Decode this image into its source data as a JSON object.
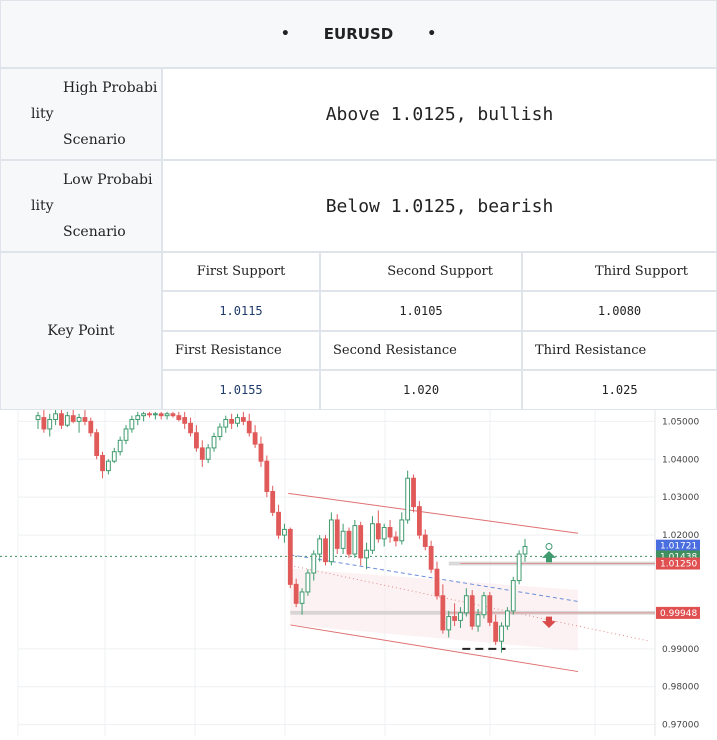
{
  "header": {
    "title": "EURUSD",
    "bullet": "•"
  },
  "rows": {
    "high": {
      "label_lines": [
        "High Probabi",
        "lity",
        "Scenario"
      ],
      "value": "Above 1.0125, bullish"
    },
    "low": {
      "label_lines": [
        "Low Probabi",
        "lity",
        "Scenario"
      ],
      "value": "Below 1.0125, bearish"
    }
  },
  "key_point": {
    "label": "Key Point",
    "support_headers": [
      "First  Support",
      "Second Support",
      "Third  Support"
    ],
    "support_values": [
      "1.0115",
      "1.0105",
      "1.0080"
    ],
    "resistance_headers": [
      "First Resistance",
      "Second Resistance",
      "Third  Resistance"
    ],
    "resistance_values": [
      "1.0155",
      "1.020",
      "1.025"
    ]
  },
  "chart_data": {
    "type": "candlestick",
    "symbol": "EURUSD",
    "y_ticks": [
      "1.05000",
      "1.04000",
      "1.03000",
      "1.02000",
      "0.99000",
      "0.98000",
      "0.97000"
    ],
    "ylim": [
      0.967,
      1.053
    ],
    "price_tags": [
      {
        "label": "1.01721",
        "value": 1.01721,
        "color": "#4a6ee0"
      },
      {
        "label": "1.01438",
        "value": 1.01438,
        "color": "#3f8f5f"
      },
      {
        "label": "1.01250",
        "value": 1.0125,
        "color": "#e05050"
      },
      {
        "label": "0.99948",
        "value": 0.99948,
        "color": "#e05050"
      }
    ],
    "candles": [
      [
        1.0505,
        1.0525,
        1.048,
        1.0515
      ],
      [
        1.051,
        1.053,
        1.047,
        1.048
      ],
      [
        1.048,
        1.052,
        1.046,
        1.0505
      ],
      [
        1.0505,
        1.053,
        1.049,
        1.052
      ],
      [
        1.052,
        1.0535,
        1.048,
        1.049
      ],
      [
        1.049,
        1.0525,
        1.0485,
        1.0515
      ],
      [
        1.0515,
        1.053,
        1.0495,
        1.05
      ],
      [
        1.05,
        1.052,
        1.047,
        1.051
      ],
      [
        1.051,
        1.053,
        1.049,
        1.05
      ],
      [
        1.05,
        1.051,
        1.046,
        1.047
      ],
      [
        1.047,
        1.048,
        1.04,
        1.041
      ],
      [
        1.041,
        1.042,
        1.035,
        1.037
      ],
      [
        1.037,
        1.04,
        1.036,
        1.0395
      ],
      [
        1.0395,
        1.043,
        1.039,
        1.042
      ],
      [
        1.042,
        1.046,
        1.041,
        1.045
      ],
      [
        1.045,
        1.049,
        1.044,
        1.048
      ],
      [
        1.048,
        1.0515,
        1.047,
        1.0505
      ],
      [
        1.0505,
        1.0525,
        1.049,
        1.0515
      ],
      [
        1.0515,
        1.0525,
        1.05,
        1.052
      ],
      [
        1.052,
        1.0525,
        1.051,
        1.0518
      ],
      [
        1.0518,
        1.0525,
        1.0505,
        1.052
      ],
      [
        1.052,
        1.0525,
        1.0505,
        1.0515
      ],
      [
        1.0515,
        1.0525,
        1.0505,
        1.052
      ],
      [
        1.052,
        1.0525,
        1.051,
        1.0515
      ],
      [
        1.0515,
        1.0525,
        1.05,
        1.0505
      ],
      [
        1.051,
        1.0525,
        1.048,
        1.0495
      ],
      [
        1.0495,
        1.051,
        1.046,
        1.047
      ],
      [
        1.047,
        1.049,
        1.042,
        1.043
      ],
      [
        1.043,
        1.045,
        1.038,
        1.04
      ],
      [
        1.04,
        1.044,
        1.039,
        1.043
      ],
      [
        1.043,
        1.047,
        1.042,
        1.046
      ],
      [
        1.046,
        1.0495,
        1.045,
        1.0485
      ],
      [
        1.0485,
        1.0515,
        1.047,
        1.0505
      ],
      [
        1.0505,
        1.052,
        1.048,
        1.0495
      ],
      [
        1.0495,
        1.052,
        1.0485,
        1.051
      ],
      [
        1.051,
        1.0525,
        1.049,
        1.05
      ],
      [
        1.05,
        1.052,
        1.046,
        1.047
      ],
      [
        1.047,
        1.049,
        1.043,
        1.044
      ],
      [
        1.044,
        1.046,
        1.038,
        1.0395
      ],
      [
        1.0395,
        1.041,
        1.03,
        1.0315
      ],
      [
        1.0315,
        1.033,
        1.025,
        1.026
      ],
      [
        1.026,
        1.028,
        1.019,
        1.02
      ],
      [
        1.02,
        1.023,
        1.018,
        1.0215
      ],
      [
        1.0215,
        1.022,
        1.006,
        1.007
      ],
      [
        1.007,
        1.0085,
        1.001,
        1.002
      ],
      [
        1.002,
        1.006,
        0.999,
        1.005
      ],
      [
        1.005,
        1.011,
        1.004,
        1.01
      ],
      [
        1.01,
        1.016,
        1.008,
        1.015
      ],
      [
        1.015,
        1.02,
        1.013,
        1.019
      ],
      [
        1.019,
        1.02,
        1.012,
        1.013
      ],
      [
        1.013,
        1.026,
        1.012,
        1.024
      ],
      [
        1.024,
        1.0255,
        1.015,
        1.0165
      ],
      [
        1.0165,
        1.023,
        1.015,
        1.021
      ],
      [
        1.021,
        1.022,
        1.014,
        1.015
      ],
      [
        1.015,
        1.024,
        1.014,
        1.0225
      ],
      [
        1.0225,
        1.0235,
        1.012,
        1.014
      ],
      [
        1.014,
        1.018,
        1.011,
        1.016
      ],
      [
        1.016,
        1.025,
        1.015,
        1.023
      ],
      [
        1.023,
        1.0265,
        1.018,
        1.019
      ],
      [
        1.019,
        1.023,
        1.017,
        1.022
      ],
      [
        1.022,
        1.024,
        1.018,
        1.0195
      ],
      [
        1.0195,
        1.021,
        1.017,
        1.0185
      ],
      [
        1.0185,
        1.026,
        1.0175,
        1.024
      ],
      [
        1.024,
        1.037,
        1.023,
        1.035
      ],
      [
        1.035,
        1.036,
        1.026,
        1.0275
      ],
      [
        1.0275,
        1.029,
        1.019,
        1.02
      ],
      [
        1.02,
        1.0215,
        1.016,
        1.017
      ],
      [
        1.017,
        1.0185,
        1.01,
        1.011
      ],
      [
        1.011,
        1.013,
        1.003,
        1.004
      ],
      [
        1.004,
        1.007,
        0.994,
        0.995
      ],
      [
        0.995,
        1.0,
        0.993,
        0.9985
      ],
      [
        0.9985,
        1.002,
        0.996,
        0.9975
      ],
      [
        0.9975,
        1.001,
        0.9955,
        0.9995
      ],
      [
        0.9995,
        1.006,
        0.9985,
        1.004
      ],
      [
        1.004,
        1.0055,
        0.995,
        0.996
      ],
      [
        0.996,
        1.0005,
        0.9945,
        0.999
      ],
      [
        0.999,
        1.005,
        0.998,
        1.004
      ],
      [
        1.004,
        1.005,
        0.996,
        0.997
      ],
      [
        0.997,
        0.999,
        0.991,
        0.992
      ],
      [
        0.992,
        0.997,
        0.989,
        0.996
      ],
      [
        0.996,
        1.001,
        0.995,
        1.0
      ],
      [
        1.0,
        1.009,
        0.999,
        1.008
      ],
      [
        1.008,
        1.016,
        1.007,
        1.015
      ],
      [
        1.015,
        1.019,
        1.013,
        1.017
      ]
    ]
  }
}
